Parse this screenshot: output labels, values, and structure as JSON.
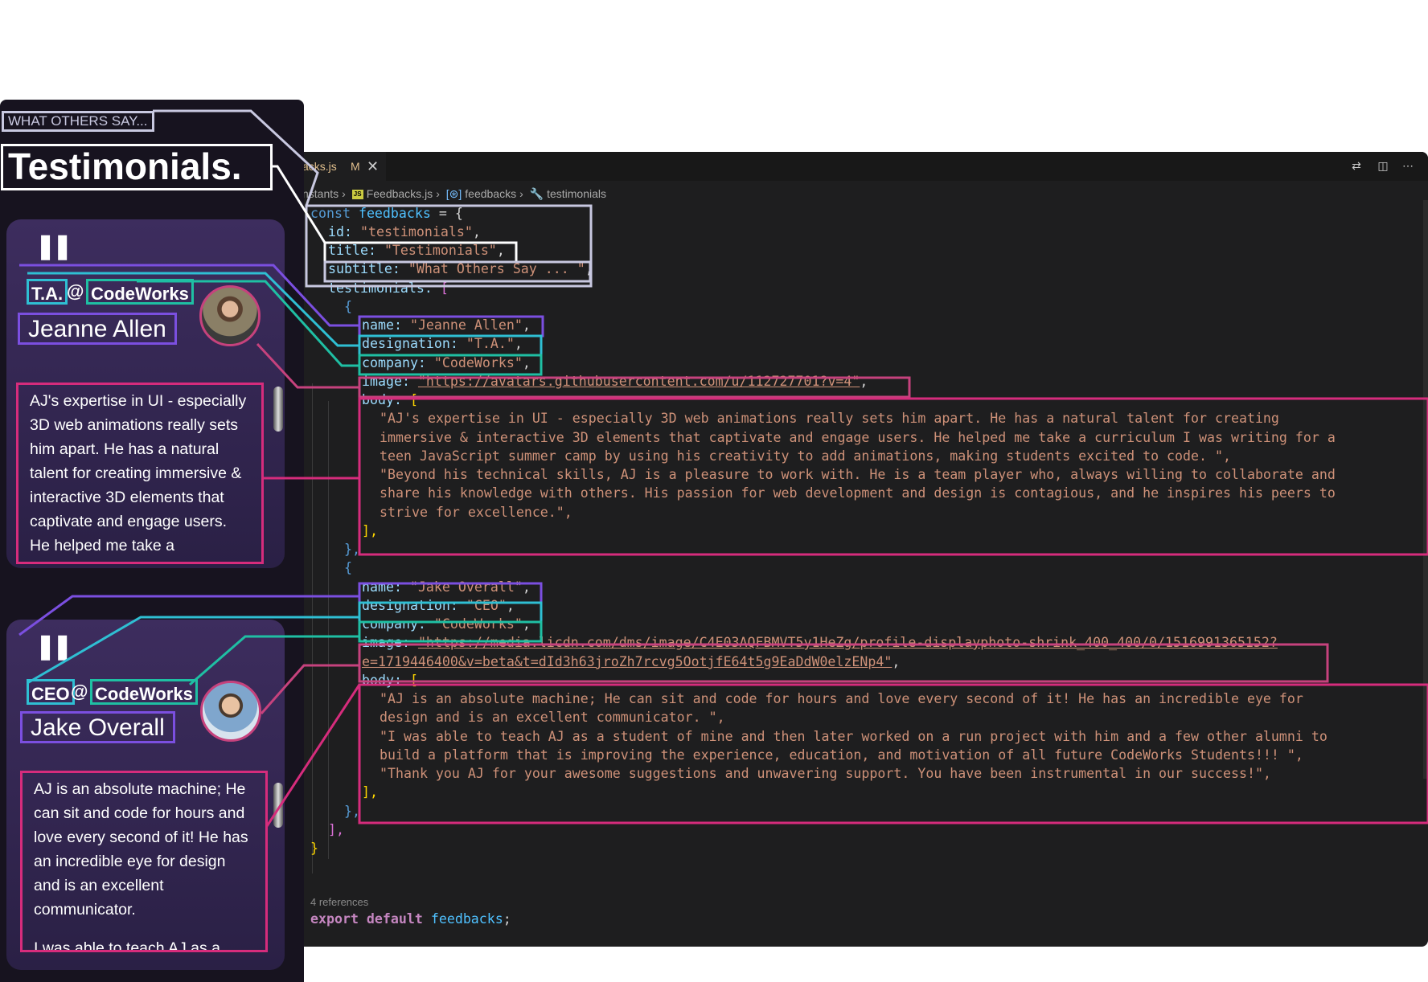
{
  "editor": {
    "tab": {
      "filename": "acks.js",
      "status": "M",
      "close": "✕"
    },
    "breadcrumb": {
      "item1": "nstants",
      "item2": "Feedbacks.js",
      "item3": "feedbacks",
      "item4": "testimonials",
      "sep": "›"
    },
    "toolbar": {
      "compare": "⇄",
      "split": "◫",
      "more": "⋯"
    },
    "references": "4 references",
    "code": {
      "l1_kw": "const",
      "l1_var": "feedbacks",
      "l1_rest": " = {",
      "id_key": "id: ",
      "id_val": "\"testimonials\"",
      "comma": ",",
      "title_key": "title: ",
      "title_val": "\"Testimonials\"",
      "subtitle_key": "subtitle: ",
      "subtitle_val": "\"What Others Say ... \"",
      "testimonials_key": "testimonials: ",
      "open_bracket": "[",
      "open_brace": "{",
      "t1_name_key": "name: ",
      "t1_name_val": "\"Jeanne Allen\"",
      "t1_des_key": "designation: ",
      "t1_des_val": "\"T.A.\"",
      "t1_co_key": "company: ",
      "t1_co_val": "\"CodeWorks\"",
      "t1_img_key": "image: ",
      "t1_img_val": "\"https://avatars.githubusercontent.com/u/112727701?v=4\"",
      "body_key": "body: ",
      "t1_b1": "\"AJ's expertise in UI - especially 3D web animations really sets him apart. He has a natural talent for creating",
      "t1_b2": "immersive & interactive 3D elements that captivate and engage users. He helped me take a curriculum I was writing for a",
      "t1_b3": "teen JavaScript summer camp by using his creativity to add animations, making students excited to code. \",",
      "t1_b4": "\"Beyond his technical skills, AJ is a pleasure to work with. He is a team player who, always willing to collaborate and",
      "t1_b5": "share his knowledge with others. His passion for web development and design is contagious, and he inspires his peers to",
      "t1_b6": "strive for excellence.\",",
      "close_bracket": "],",
      "close_brace": "},",
      "t2_name_key": "name: ",
      "t2_name_val": "\"Jake Overall\"",
      "t2_des_key": "designation: ",
      "t2_des_val": "\"CEO\"",
      "t2_co_key": "company: ",
      "t2_co_val": "\"CodeWorks\"",
      "t2_img_key": "image: ",
      "t2_img_val1": "\"https://media.licdn.com/dms/image/C4E03AQFBMVT5y1HeZg/profile-displayphoto-shrink_400_400/0/1516991365152?",
      "t2_img_val2": "e=1719446400&v=beta&t=dId3h63jroZh7rcvg5OotjfE64t5g9EaDdW0elzENp4\"",
      "t2_b1": "\"AJ is an absolute machine; He can sit and code for hours and love every second of it! He has an incredible eye for",
      "t2_b2": "design and is an excellent communicator. \",",
      "t2_b3": "\"I was able to teach AJ as a student of mine and then later worked on a run project with him and a few other alumni to",
      "t2_b4": "build a platform that is improving the experience, education, and motivation of all future CodeWorks Students!!! \",",
      "t2_b5": "\"Thank you AJ for your awesome suggestions and unwavering support. You have been instrumental in our success!\",",
      "end_bracket": "],",
      "end_brace": "}",
      "export_kw": "export default ",
      "export_var": "feedbacks",
      "export_end": ";"
    }
  },
  "panel": {
    "subtitle": "WHAT OTHERS SAY...",
    "title": "Testimonials.",
    "quote_mark": "❚❚",
    "at": "@",
    "testimonials": [
      {
        "designation": "T.A.",
        "company": "CodeWorks",
        "name": "Jeanne Allen",
        "body": "AJ's expertise in UI - especially 3D web animations really sets him apart. He has a natural talent for creating immersive & interactive 3D elements that captivate and engage users. He helped me take a curriculum I"
      },
      {
        "designation": "CEO",
        "company": "CodeWorks",
        "name": "Jake Overall",
        "body": "AJ is an absolute machine; He can sit and code for hours and love every second of it! He has an incredible eye for design and is an excellent communicator.",
        "body2": "I was able to teach AJ as a"
      }
    ]
  },
  "colors": {
    "title_outline": "#ffffff",
    "subtitle_outline": "#c8c8e0",
    "name_outline": "#7b4fe0",
    "designation_outline": "#2fbfd3",
    "company_outline": "#1fbfa3",
    "image_outline": "#c6427d",
    "body_outline": "#d62c7c"
  }
}
